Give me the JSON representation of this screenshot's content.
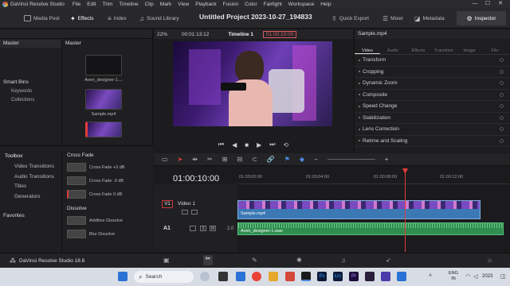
{
  "app": {
    "name": "DaVinci Resolve Studio",
    "menu": [
      "File",
      "Edit",
      "Trim",
      "Timeline",
      "Clip",
      "Mark",
      "View",
      "Playback",
      "Fusion",
      "Color",
      "Fairlight",
      "Workspace",
      "Help"
    ]
  },
  "toolbar": {
    "media_pool": "Media Pool",
    "effects": "Effects",
    "index": "Index",
    "sound_library": "Sound Library",
    "project_title": "Untitled Project 2023-10-27_194833",
    "quick_export": "Quick Export",
    "mixer": "Mixer",
    "metadata": "Metadata",
    "inspector": "Inspector"
  },
  "media_pool": {
    "master_left": "Master",
    "master_right": "Master",
    "smart_bins": "Smart Bins",
    "bins": [
      "Keywords",
      "Collections"
    ],
    "clips": [
      {
        "name": "Aven_designer-1...."
      },
      {
        "name": "Sample.mp4"
      },
      {
        "name": ""
      }
    ]
  },
  "viewer": {
    "zoom": "22%",
    "timecode": "00:01:13:12",
    "timeline_name": "Timeline 1",
    "timecode_right": "01:00:10:00"
  },
  "inspector": {
    "clip_name": "Sample.mp4",
    "tabs": [
      "Video",
      "Audio",
      "Effects",
      "Transition",
      "Image",
      "File"
    ],
    "items": [
      "Transform",
      "Cropping",
      "Dynamic Zoom",
      "Composite",
      "Speed Change",
      "Stabilization",
      "Lens Correction",
      "Retime and Scaling"
    ]
  },
  "effects_panel": {
    "toolbox_label": "Toolbox",
    "categories": [
      "Video Transitions",
      "Audio Transitions",
      "Titles",
      "Generators"
    ],
    "favorites_label": "Favorites",
    "cross_fade_header": "Cross Fade",
    "cross_fades": [
      "Cross Fade +3 dB",
      "Cross Fade -3 dB",
      "Cross Fade 0 dB"
    ],
    "dissolve_header": "Dissolve",
    "dissolves": [
      "Additive Dissolve",
      "Blur Dissolve"
    ]
  },
  "timeline": {
    "timecode": "01:00:10:00",
    "ruler_labels": [
      "01:00:00:00",
      "01:00:04:00",
      "01:00:08:00",
      "01:00:12:00"
    ],
    "video_track": {
      "id": "V1",
      "name": "Video 1",
      "clip": "Sample.mp4"
    },
    "audio_track": {
      "id": "A1",
      "level": "2.0",
      "clip": "Aven_designer-1.wav"
    }
  },
  "footer": {
    "product": "DaVinci Resolve Studio 18.6"
  },
  "taskbar": {
    "search_placeholder": "Search",
    "lang_top": "ENG",
    "lang_bottom": "IN",
    "year": "2023"
  },
  "colors": {
    "accent_red": "#e23b3b",
    "video_clip": "#3b78b4",
    "audio_clip": "#2e8d4f"
  }
}
